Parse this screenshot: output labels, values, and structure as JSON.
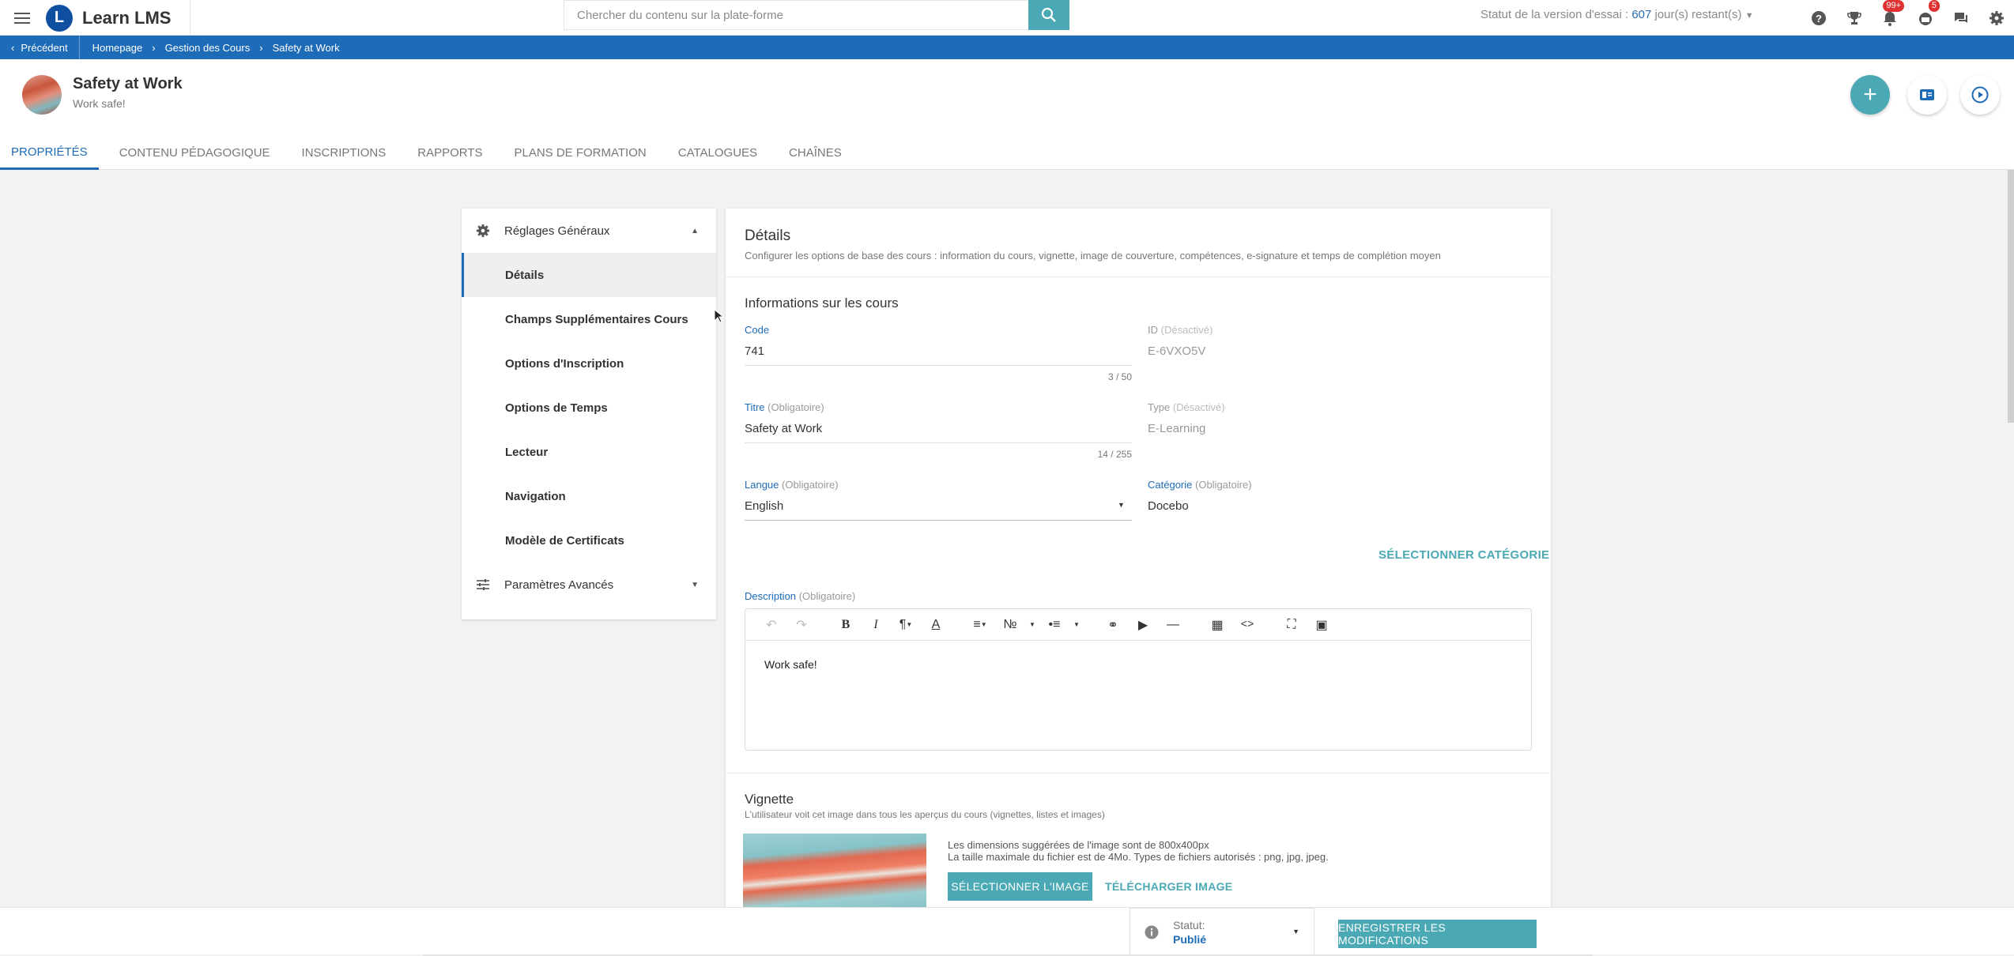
{
  "app": {
    "name": "Learn LMS",
    "logo_letter": "L"
  },
  "search": {
    "placeholder": "Chercher du contenu sur la plate-forme"
  },
  "trial": {
    "prefix": "Statut de la version d'essai : ",
    "days": "607",
    "suffix": " jour(s) restant(s)"
  },
  "top_icons": {
    "notifications_badge": "99+",
    "chat_badge": "5"
  },
  "breadcrumb": {
    "back_label": "Précédent",
    "items": [
      "Homepage",
      "Gestion des Cours",
      "Safety at Work"
    ]
  },
  "course": {
    "title": "Safety at Work",
    "subtitle": "Work safe!"
  },
  "tabs": [
    {
      "label": "PROPRIÉTÉS"
    },
    {
      "label": "CONTENU PÉDAGOGIQUE"
    },
    {
      "label": "INSCRIPTIONS"
    },
    {
      "label": "RAPPORTS"
    },
    {
      "label": "PLANS DE FORMATION"
    },
    {
      "label": "CATALOGUES"
    },
    {
      "label": "CHAÎNES"
    }
  ],
  "sidebar": {
    "general_header": "Réglages Généraux",
    "items": [
      {
        "label": "Détails"
      },
      {
        "label": "Champs Supplémentaires Cours"
      },
      {
        "label": "Options d'Inscription"
      },
      {
        "label": "Options de Temps"
      },
      {
        "label": "Lecteur"
      },
      {
        "label": "Navigation"
      },
      {
        "label": "Modèle de Certificats"
      }
    ],
    "advanced_header": "Paramètres Avancés"
  },
  "details": {
    "title": "Détails",
    "description": "Configurer les options de base des cours : information du cours, vignette, image de couverture, compétences, e-signature et temps de complétion moyen"
  },
  "info": {
    "title": "Informations sur les cours",
    "code_label": "Code",
    "code_value": "741",
    "code_counter": "3 / 50",
    "id_label": "ID",
    "id_note": "(Désactivé)",
    "id_value": "E-6VXO5V",
    "title_label": "Titre",
    "required_note": "(Obligatoire)",
    "title_value": "Safety at Work",
    "title_counter": "14 / 255",
    "type_label": "Type",
    "type_note": "(Désactivé)",
    "type_value": "E-Learning",
    "language_label": "Langue",
    "language_value": "English",
    "category_label": "Catégorie",
    "category_value": "Docebo",
    "select_category": "SÉLECTIONNER CATÉGORIE",
    "description_label": "Description",
    "description_text": "Work safe!"
  },
  "vignette": {
    "title": "Vignette",
    "description": "L'utilisateur voit cet image dans tous les aperçus du cours (vignettes, listes et images)",
    "note1": "Les dimensions suggérées de l'image sont de 800x400px",
    "note2": "La taille maximale du fichier est de 4Mo. Types de fichiers autorisés : png, jpg, jpeg.",
    "select_button": "SÉLECTIONNER L'IMAGE",
    "upload_button": "TÉLÉCHARGER IMAGE"
  },
  "footer": {
    "status_label": "Statut:",
    "status_value": "Publié",
    "save_button": "ENREGISTRER LES MODIFICATIONS"
  },
  "colors": {
    "primary_blue": "#1e6bb8",
    "teal": "#4aa9b4"
  }
}
